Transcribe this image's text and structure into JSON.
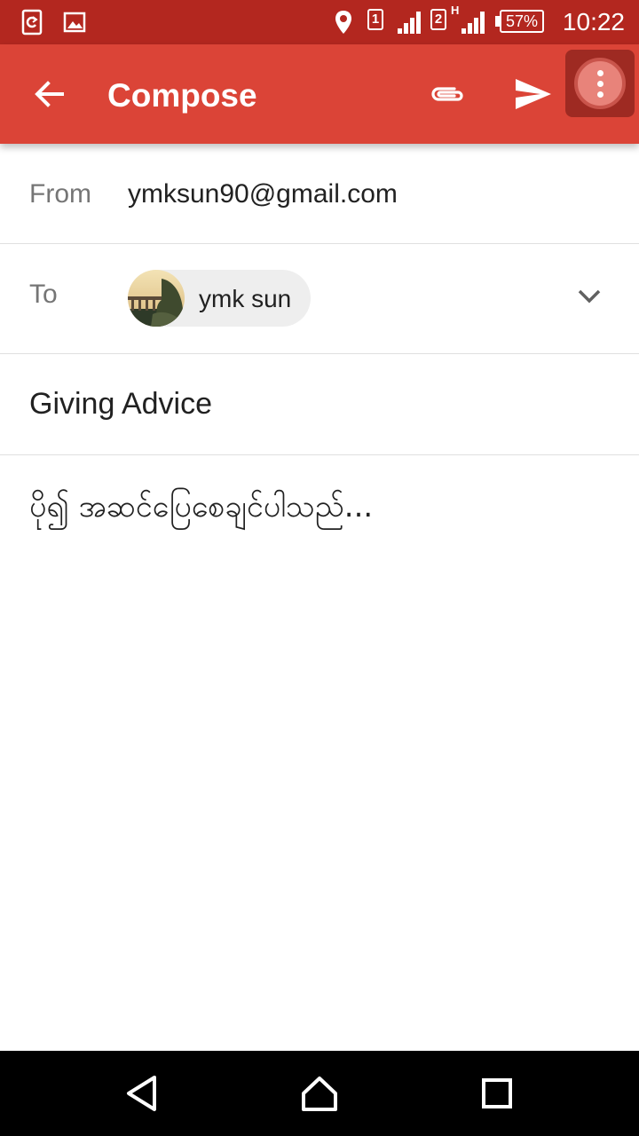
{
  "status_bar": {
    "time": "10:22",
    "battery_percent": "57%",
    "sim1": "1",
    "sim2": "2",
    "network_type": "H",
    "icons": [
      "sync-icon",
      "image-icon",
      "location-icon",
      "signal-icon",
      "battery-icon"
    ]
  },
  "app_bar": {
    "title": "Compose",
    "icons": [
      "back-arrow-icon",
      "attach-icon",
      "send-icon",
      "more-vert-icon"
    ]
  },
  "from": {
    "label": "From",
    "value": "ymksun90@gmail.com"
  },
  "to": {
    "label": "To",
    "recipient": "ymk sun"
  },
  "subject": "Giving Advice",
  "body": "ပို၍ အဆင်ပြေစေချင်ပါသည်...",
  "nav_bar": {
    "icons": [
      "back-triangle-icon",
      "home-icon",
      "recents-icon"
    ]
  },
  "colors": {
    "status_bar": "#b3271f",
    "app_bar": "#db4437",
    "highlight": "#9e2a22"
  }
}
